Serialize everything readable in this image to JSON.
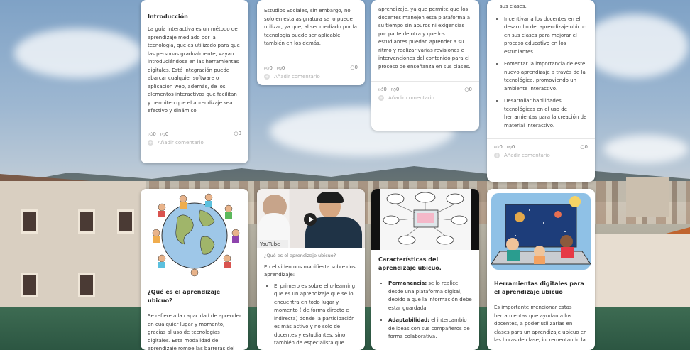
{
  "colors": {
    "card_bg": "#ffffff",
    "text": "#3a3a3a",
    "muted": "#b0b0b0"
  },
  "icons": {
    "like": "thumb-up-icon",
    "dislike": "thumb-down-icon",
    "comment": "comment-icon",
    "menu": "kebab-menu-icon",
    "play": "play-icon"
  },
  "card1": {
    "title": "Introducción",
    "body": "La guía interactiva es un método de aprendizaje mediado por la tecnología, que es utilizado para que las personas gradualmente, vayan introduciéndose en las herramientas digitales. Está integración puede abarcar cualquier software o aplicación web, además, de los elementos interactivos que facilitan y permiten que el aprendizaje sea efectivo y dinámico.",
    "likes": "0",
    "dislikes": "0",
    "comments": "0",
    "add_comment": "Añadir comentario"
  },
  "card2": {
    "body": "Estudios Sociales, sin embargo, no solo en esta asignatura se lo puede utilizar, ya que, al ser mediado por la tecnología puede ser aplicable también en los demás.",
    "likes": "0",
    "dislikes": "0",
    "comments": "0",
    "add_comment": "Añadir comentario"
  },
  "card3": {
    "body": "aprendizaje, ya que permite que los docentes manejen esta plataforma a su tiempo sin apuros ni exigencias por parte de otra y que los estudiantes puedan aprender a su ritmo y realizar varias revisiones e intervenciones del contenido para el proceso de enseñanza en sus clases.",
    "likes": "0",
    "dislikes": "0",
    "comments": "0",
    "add_comment": "Añadir comentario"
  },
  "card4": {
    "top": "sus clases.",
    "items": [
      "Incentivar a los docentes en el desarrollo del aprendizaje ubicuo en sus clases para mejorar el proceso educativo en los estudiantes.",
      "Fomentar la importancia de este nuevo aprendizaje a través de la tecnológica, promoviendo un ambiente interactivo.",
      "Desarrollar habilidades tecnológicas en el uso de herramientas para la creación de material interactivo."
    ],
    "likes": "0",
    "dislikes": "0",
    "comments": "0",
    "add_comment": "Añadir comentario"
  },
  "card5": {
    "title": "¿Qué es el aprendizaje ubicuo?",
    "body": "Se refiere a la capacidad de aprender en cualquier lugar y momento, gracias al uso de tecnologías digitales. Esta modalidad de aprendizaje rompe las barreras del"
  },
  "card6": {
    "source": "YouTube",
    "caption": "¿Qué es el aprendizaje ubicuo?",
    "intro": "En el video nos manifiesta sobre dos aprendizaje:",
    "item": "El primero es sobre el u-learning que es un aprendizaje que se lo encuentra en todo lugar y momento ( de forma directo e indirecta) donde la participación es más activo y no solo de docentes y estudiantes, sino también de especialista que"
  },
  "card7": {
    "title": "Características del aprendizaje ubicuo.",
    "items": [
      {
        "term": "Permanencia:",
        "text": " se lo realice desde una plataforma digital, debido a que la información debe estar guardada."
      },
      {
        "term": "Adaptabilidad:",
        "text": " el intercambio de ideas con sus compañeros de forma colaborativa."
      }
    ]
  },
  "card8": {
    "title": "Herramientas digitales para el aprendizaje ubicuo",
    "body": "Es importante mencionar estas herramientas que ayudan a los docentes, a poder utilizarlas en clases para un aprendizaje ubicuo en las horas de clase, incrementando la"
  }
}
